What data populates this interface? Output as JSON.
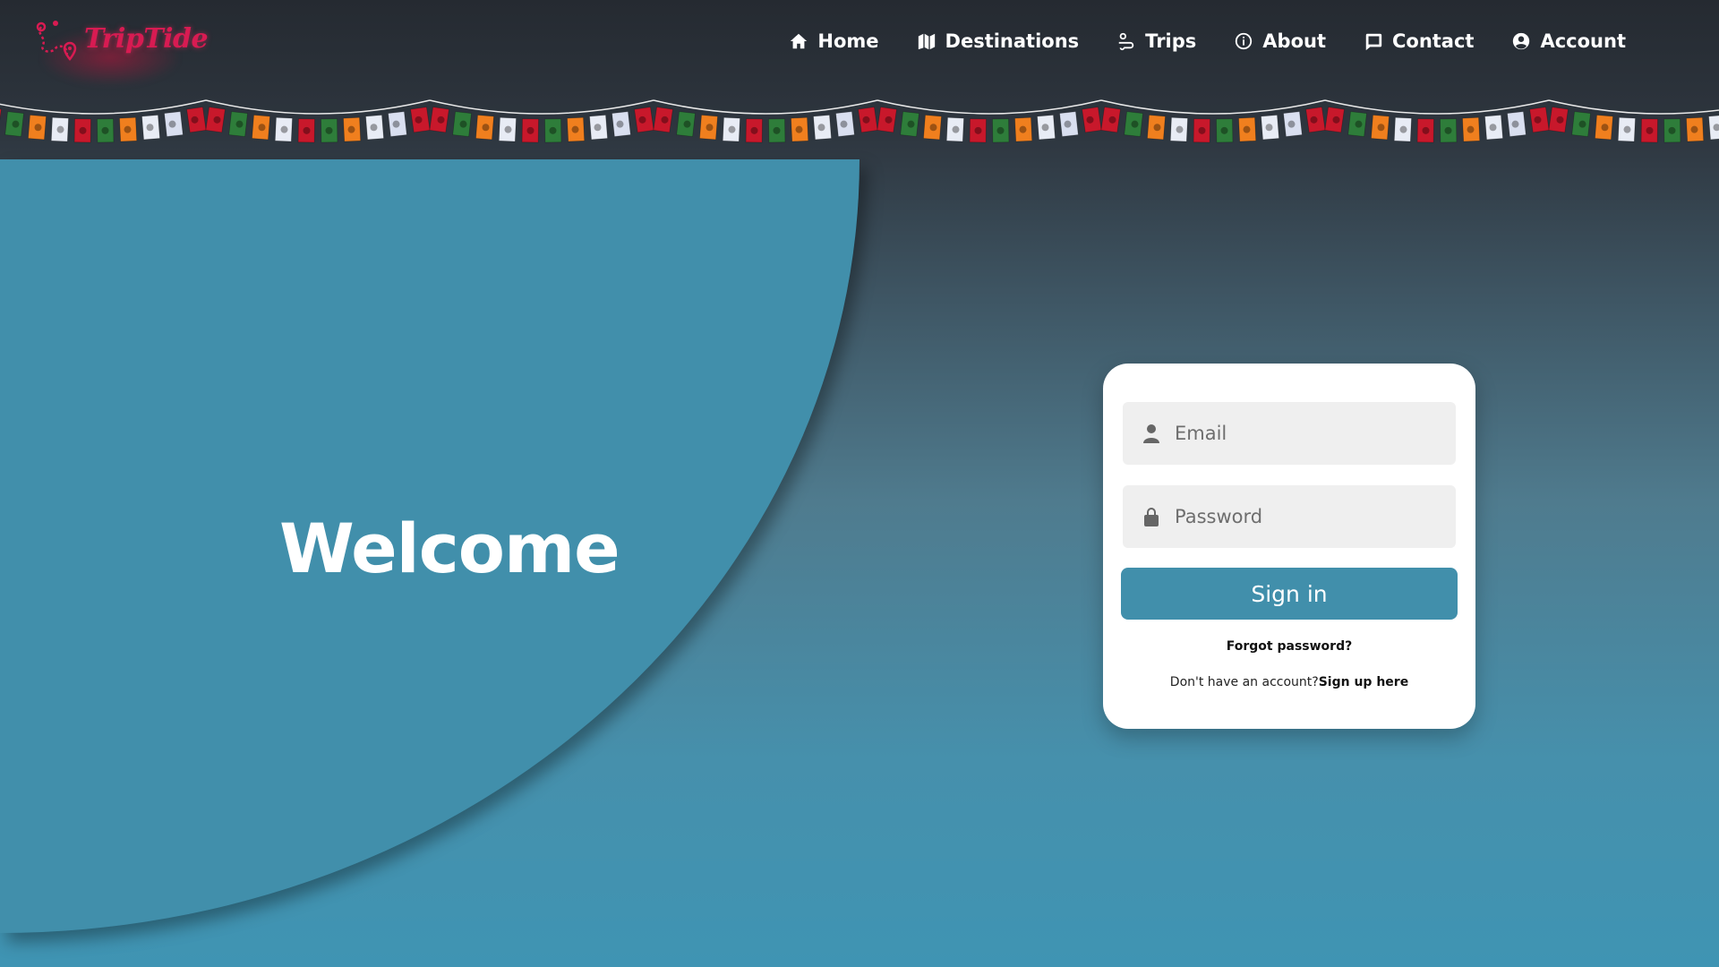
{
  "brand": {
    "name": "TripTide"
  },
  "nav": {
    "items": [
      {
        "label": "Home",
        "icon": "home-icon"
      },
      {
        "label": "Destinations",
        "icon": "map-icon"
      },
      {
        "label": "Trips",
        "icon": "trips-icon"
      },
      {
        "label": "About",
        "icon": "info-icon"
      },
      {
        "label": "Contact",
        "icon": "chat-icon"
      },
      {
        "label": "Account",
        "icon": "user-circle-icon"
      }
    ]
  },
  "hero": {
    "title": "Welcome"
  },
  "login": {
    "email_placeholder": "Email",
    "password_placeholder": "Password",
    "signin_label": "Sign in",
    "forgot_label": "Forgot password?",
    "no_account_text": "Don't have an account?",
    "signup_label": "Sign up here"
  },
  "colors": {
    "accent": "#418fab",
    "brand": "#d81b52",
    "card_bg": "#ffffff",
    "field_bg": "#efefef"
  }
}
